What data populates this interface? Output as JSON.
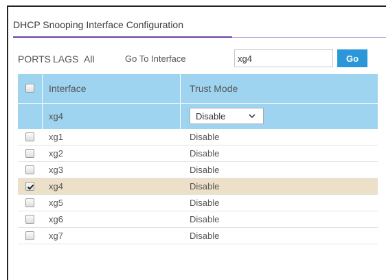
{
  "title": "DHCP Snooping Interface Configuration",
  "toolbar": {
    "ports_label": "PORTS",
    "lags_label": "LAGS",
    "all_label": "All",
    "goto_label": "Go To Interface",
    "goto_value": "xg4",
    "go_button": "Go"
  },
  "table": {
    "headers": {
      "interface": "Interface",
      "trust_mode": "Trust Mode"
    },
    "edit_row": {
      "interface": "xg4",
      "trust_mode_selected": "Disable"
    },
    "rows": [
      {
        "interface": "xg1",
        "trust_mode": "Disable",
        "checked": false
      },
      {
        "interface": "xg2",
        "trust_mode": "Disable",
        "checked": false
      },
      {
        "interface": "xg3",
        "trust_mode": "Disable",
        "checked": false
      },
      {
        "interface": "xg4",
        "trust_mode": "Disable",
        "checked": true
      },
      {
        "interface": "xg5",
        "trust_mode": "Disable",
        "checked": false
      },
      {
        "interface": "xg6",
        "trust_mode": "Disable",
        "checked": false
      },
      {
        "interface": "xg7",
        "trust_mode": "Disable",
        "checked": false
      }
    ]
  },
  "colors": {
    "accent": "#6b3fa0",
    "header_bg": "#9ed4f0",
    "selected_row_bg": "#ede0c8",
    "button_bg": "#2b97d9"
  }
}
